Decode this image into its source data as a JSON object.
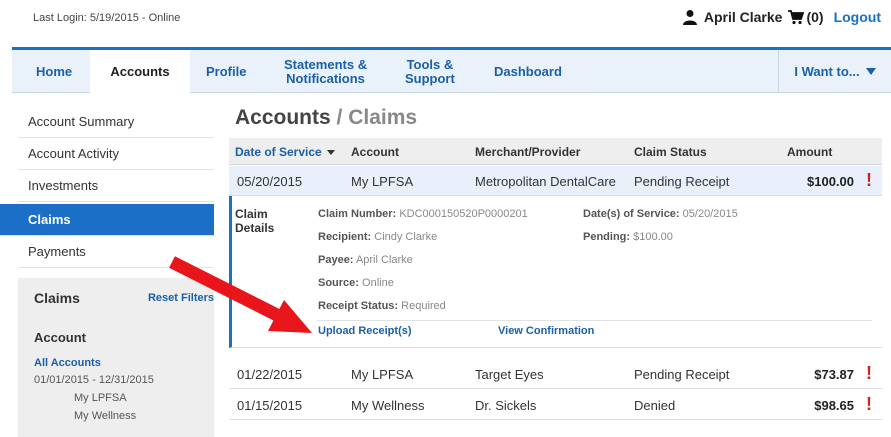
{
  "header": {
    "last_login": "Last Login: 5/19/2015 - Online",
    "user_name": "April Clarke",
    "cart_count": "(0)",
    "logout": "Logout"
  },
  "nav": {
    "home": "Home",
    "accounts": "Accounts",
    "profile": "Profile",
    "statements_line1": "Statements &",
    "statements_line2": "Notifications",
    "tools_line1": "Tools &",
    "tools_line2": "Support",
    "dashboard": "Dashboard",
    "i_want": "I Want to..."
  },
  "sidebar": {
    "items": [
      "Account Summary",
      "Account Activity",
      "Investments",
      "Claims",
      "Payments"
    ],
    "filter_title": "Claims",
    "reset_filters": "Reset Filters",
    "account_heading": "Account",
    "all_accounts": "All Accounts",
    "date_range": "01/01/2015 - 12/31/2015",
    "accounts": [
      "My LPFSA",
      "My Wellness"
    ]
  },
  "main": {
    "title": "Accounts",
    "separator": "/",
    "crumb": "Claims",
    "columns": {
      "date": "Date of Service",
      "account": "Account",
      "merchant": "Merchant/Provider",
      "status": "Claim Status",
      "amount": "Amount"
    },
    "rows": [
      {
        "date": "05/20/2015",
        "account": "My LPFSA",
        "merchant": "Metropolitan DentalCare",
        "status": "Pending Receipt",
        "amount": "$100.00",
        "alert": "!"
      },
      {
        "date": "01/22/2015",
        "account": "My LPFSA",
        "merchant": "Target Eyes",
        "status": "Pending Receipt",
        "amount": "$73.87",
        "alert": "!"
      },
      {
        "date": "01/15/2015",
        "account": "My Wellness",
        "merchant": "Dr. Sickels",
        "status": "Denied",
        "amount": "$98.65",
        "alert": "!"
      }
    ],
    "details": {
      "title_line1": "Claim",
      "title_line2": "Details",
      "claim_number_label": "Claim Number:",
      "claim_number": "KDC000150520P0000201",
      "recipient_label": "Recipient:",
      "recipient": "Cindy Clarke",
      "payee_label": "Payee:",
      "payee": "April Clarke",
      "source_label": "Source:",
      "source": "Online",
      "receipt_status_label": "Receipt Status:",
      "receipt_status": "Required",
      "dos_label": "Date(s) of Service:",
      "dos": "05/20/2015",
      "pending_label": "Pending:",
      "pending": "$100.00",
      "upload_link": "Upload Receipt(s)",
      "confirmation_link": "View Confirmation"
    }
  },
  "colors": {
    "brand_blue": "#1b6fc7",
    "link_blue": "#1b5fa8",
    "alert_red": "#d21f1f",
    "arrow_red": "#e8151b"
  }
}
